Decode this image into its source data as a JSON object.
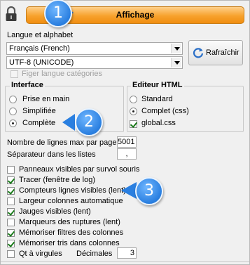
{
  "header": {
    "title": "Affichage"
  },
  "badges": [
    "1",
    "2",
    "3"
  ],
  "lang": {
    "section_label": "Langue et alphabet",
    "language_value": "Français (French)",
    "encoding_value": "UTF-8 (UNICODE)",
    "freeze_label": "Figer langue catégories",
    "refresh_label": "Rafraîchir"
  },
  "interface": {
    "title": "Interface",
    "options": [
      "Prise en main",
      "Simplifiée",
      "Complète"
    ],
    "selected": 2
  },
  "editor": {
    "title": "Editeur HTML",
    "options": [
      "Standard",
      "Complet (css)"
    ],
    "selected": 1,
    "css_label": "global.css"
  },
  "fields": {
    "max_lines_label": "Nombre de lignes max par page",
    "max_lines_value": "5001",
    "separator_label": "Séparateur dans les listes",
    "separator_value": ","
  },
  "checkboxes": [
    {
      "label": "Panneaux visibles par survol souris",
      "checked": false
    },
    {
      "label": "Tracer (fenêtre de log)",
      "checked": true
    },
    {
      "label": "Compteurs lignes visibles (lent)",
      "checked": true
    },
    {
      "label": "Largeur colonnes automatique",
      "checked": false
    },
    {
      "label": "Jauges visibles (lent)",
      "checked": true
    },
    {
      "label": "Marqueurs des ruptures (lent)",
      "checked": false
    },
    {
      "label": "Mémoriser filtres des colonnes",
      "checked": true
    },
    {
      "label": "Mémoriser tris dans colonnes",
      "checked": true
    },
    {
      "label": "Qt à virgules",
      "checked": false
    }
  ],
  "decimals": {
    "label": "Décimales",
    "value": "3"
  },
  "colors": {
    "accent": "#f7a22d",
    "badge": "#2a7fe0",
    "check": "#1a7a1a"
  }
}
